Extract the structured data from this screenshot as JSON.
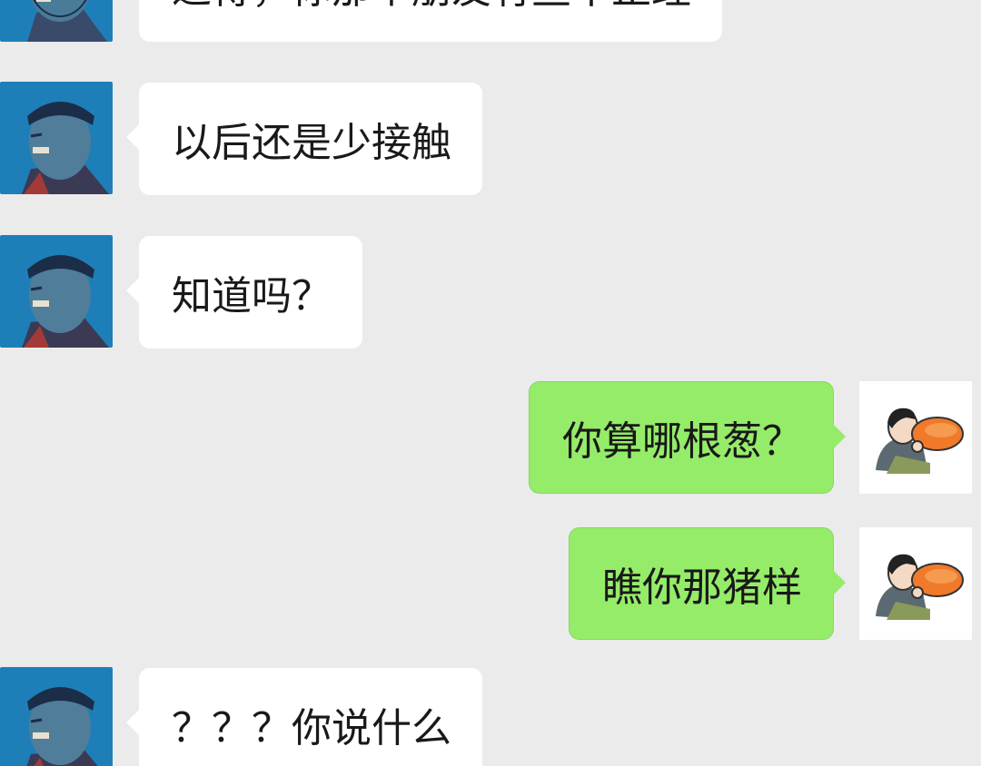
{
  "messages": [
    {
      "side": "left",
      "text": "过得，你那个朋友有些不正经"
    },
    {
      "side": "left",
      "text": "以后还是少接触"
    },
    {
      "side": "left",
      "text": "知道吗？"
    },
    {
      "side": "right",
      "text": "你算哪根葱？"
    },
    {
      "side": "right",
      "text": "瞧你那猪样"
    },
    {
      "side": "left",
      "text": "？？？你说什么"
    }
  ],
  "colors": {
    "background": "#ebebeb",
    "incoming_bubble": "#ffffff",
    "outgoing_bubble": "#95ec69",
    "contact_avatar_bg": "#1e7fb8"
  },
  "icons": {
    "contact_avatar": "man-headband-avatar",
    "self_avatar": "cartoon-man-eating-sweet-potato-avatar"
  }
}
